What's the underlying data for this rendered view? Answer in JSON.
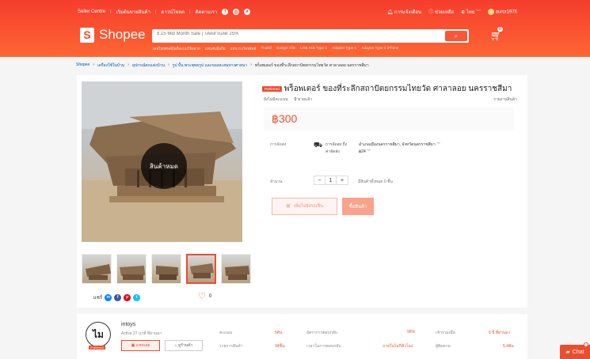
{
  "header": {
    "seller_centre": "Seller Centre",
    "start_selling": "เริ่มต้นขายสินค้า",
    "download": "ดาวน์โหลด",
    "follow_us": "ติดตามเรา",
    "notifications": "การแจ้งเตือน",
    "help": "ช่วยเหลือ",
    "language": "ไทย",
    "username": "auror1976",
    "logo_text": "Shopee",
    "search_placeholder": "8.15 Mid Month Sale | โค้ดส่วนลด 25%",
    "cart_count": "0",
    "suggestions": [
      "เคสโทรศัพท์มือถือแบบใช้ตลาด",
      "แท่นจับมือถือ",
      "แท่นวางโทรศัพท์",
      "Thailaf",
      "Gadget Ville",
      "USB Hub Type C",
      "Adapter Type C",
      "Adapter Type C iPhone"
    ]
  },
  "breadcrumb": [
    "Shopee",
    "เครื่องใช้ในบ้าน",
    "อุปกรณ์ตกแต่งบ้าน",
    "รูป ปั้น พระพุทธรูป และของสะสมทางศาสนา",
    "พร็อพเตอร์ ของที่ระลึกสถาปัตยกรรมไทยวัด ศาลาลอย นครราชสีมา"
  ],
  "product": {
    "badge": "Preferred",
    "title": "พร็อพเตอร์ ของที่ระลึกสถาปัตยกรรมไทยวัด ศาลาลอย นครราชสีมา",
    "no_rating": "ยังไม่มีคะแนน",
    "sold_count": "0",
    "sold_label": "ขายแล้ว",
    "report": "รายงานสินค้า",
    "price": "฿300",
    "sold_out_label": "สินค้าหมด",
    "shipping_label": "การจัดส่ง",
    "ship_to_label": "การจัดส่ง ถึง",
    "ship_fee_label": "ค่าจัดส่ง",
    "ship_to_value": "อำเภอเมืองนครราชสีมา, จังหวัดนครราชสีมา",
    "ship_fee_value": "฿24",
    "qty_label": "จำนวน",
    "qty_value": "1",
    "qty_minus": "−",
    "qty_plus": "+",
    "qty_available": "มีสินค้าทั้งหมด 0 ชิ้น",
    "add_to_cart": "เพิ่มไปยังรถเข็น",
    "buy_now": "ซื้อสินค้า",
    "share_label": "แชร์",
    "fav_count": "0"
  },
  "shop": {
    "avatar_text": "ไม",
    "preferred": "Preferred",
    "name": "intoys",
    "active": "Active 27 นาที ที่ผ่านมา",
    "chat": "แชทเลย",
    "view": "ดูร้านค้า",
    "stats": [
      {
        "label": "คะแนน",
        "value": "5ตัน"
      },
      {
        "label": "รายการสินค้า",
        "value": "34ชิ้น"
      },
      {
        "label": "อัตราการตอบกลับ",
        "value": "96%"
      },
      {
        "label": "เวลาในการตอบกลับ",
        "value": "ภายในไม่กี่ชั่วโมง"
      },
      {
        "label": "เข้าร่วมเมื่อ",
        "value": "6 ปี ที่ผ่านมา"
      },
      {
        "label": "ผู้ติดตาม",
        "value": "5.4พัน"
      }
    ]
  },
  "chat_fab": "Chat"
}
